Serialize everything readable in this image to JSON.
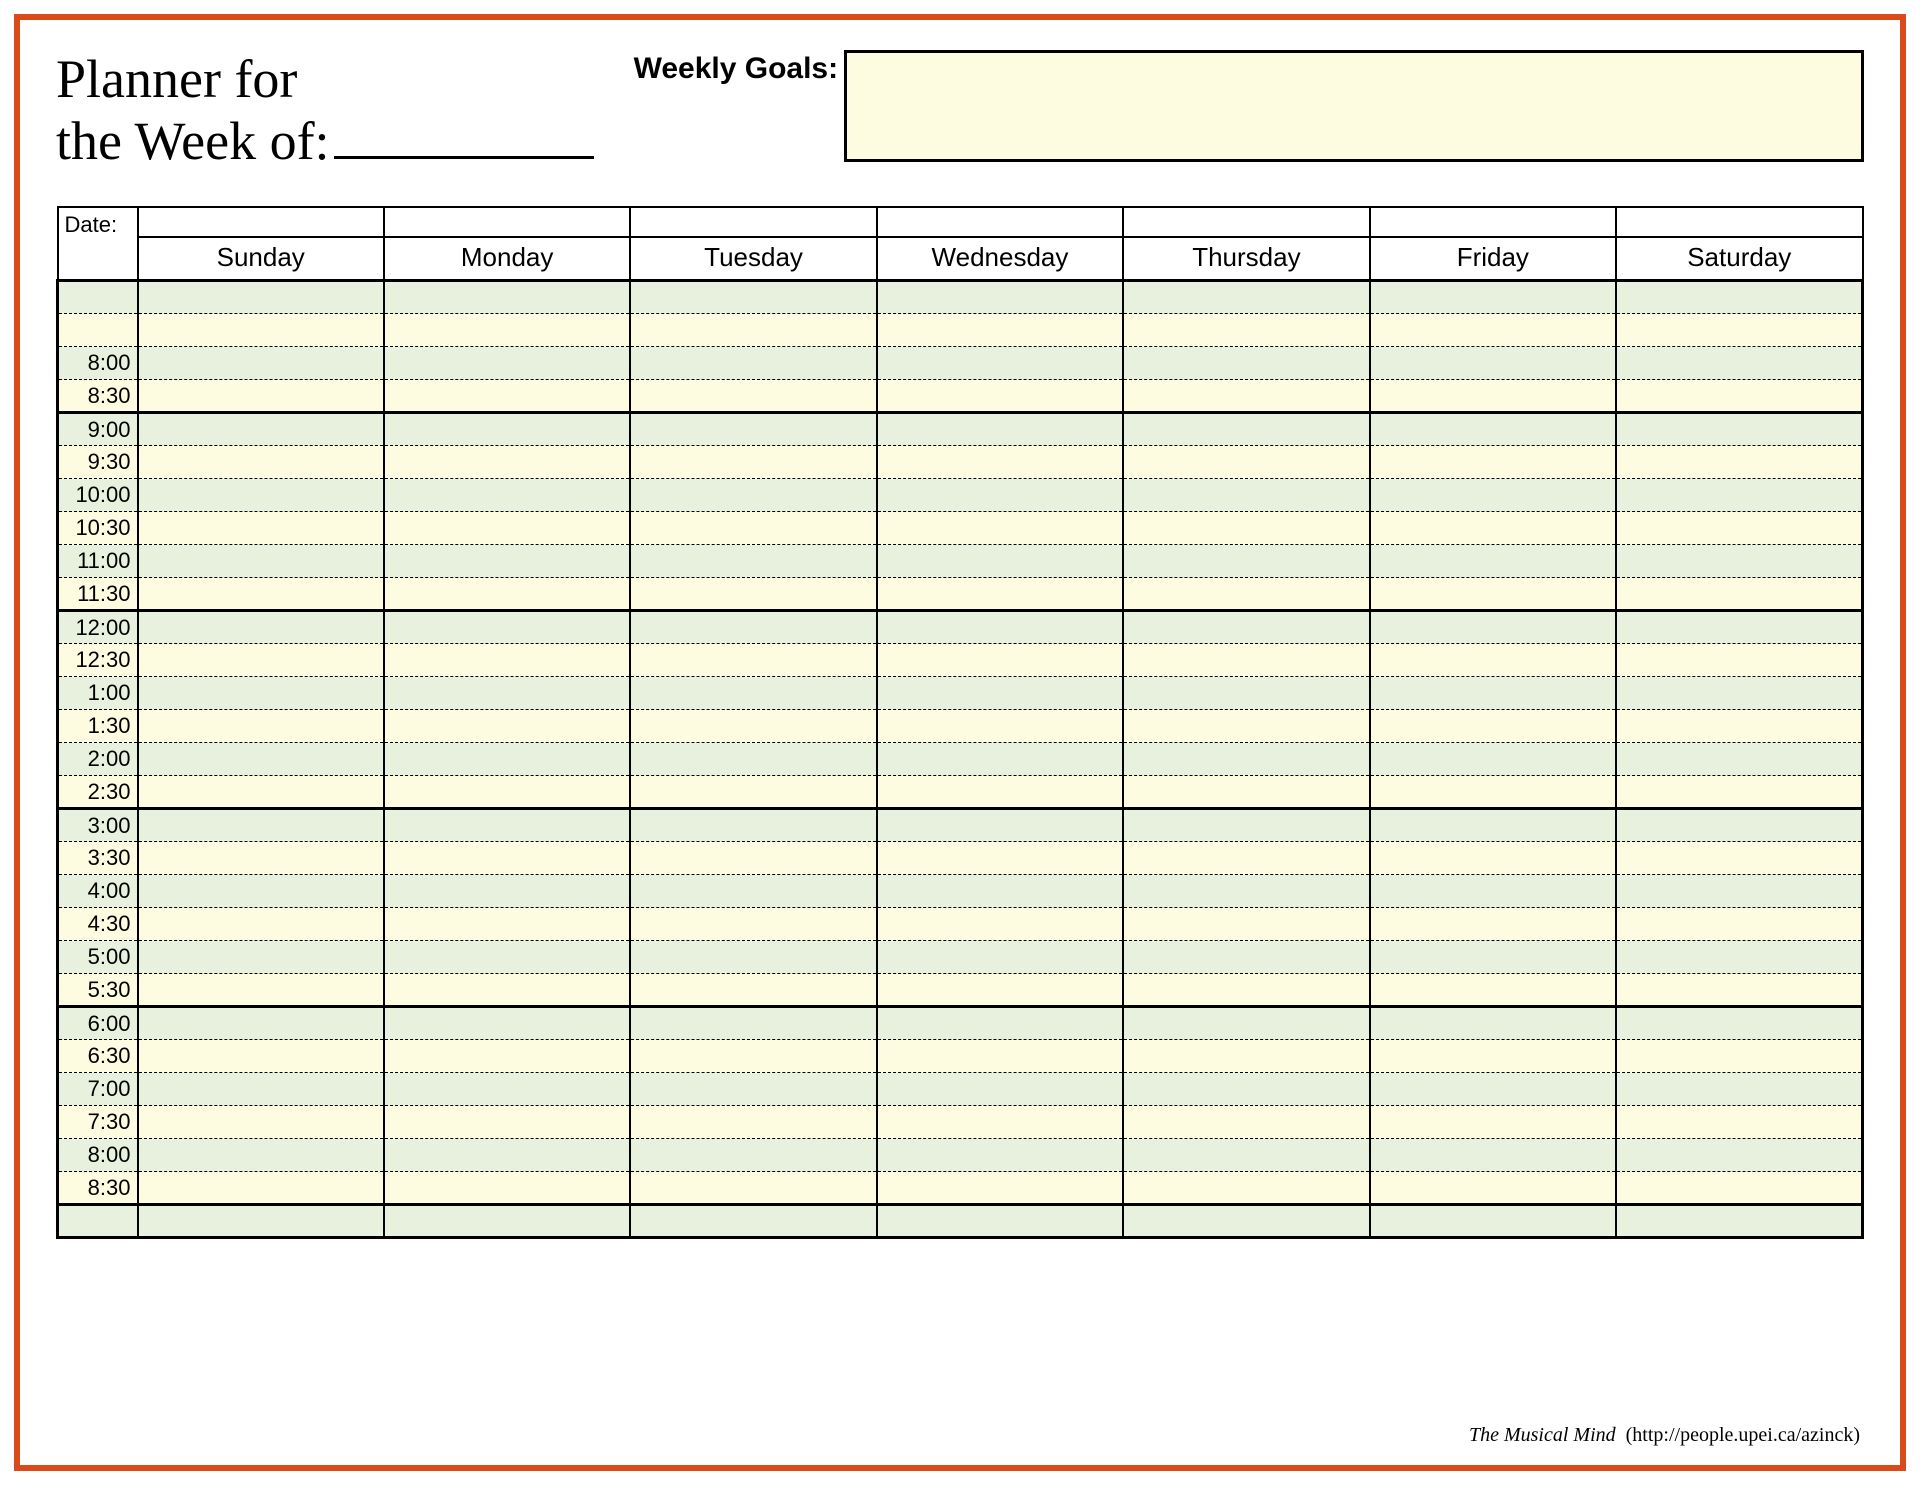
{
  "header": {
    "title_line1": "Planner for",
    "title_line2": "the Week of:",
    "goals_label": "Weekly Goals:"
  },
  "table": {
    "date_label": "Date:",
    "days": [
      "Sunday",
      "Monday",
      "Tuesday",
      "Wednesday",
      "Thursday",
      "Friday",
      "Saturday"
    ],
    "rows": [
      {
        "time": "",
        "shade": "green",
        "section": true
      },
      {
        "time": "",
        "shade": "cream",
        "section": false
      },
      {
        "time": "8:00",
        "shade": "green",
        "section": false
      },
      {
        "time": "8:30",
        "shade": "cream",
        "section": false
      },
      {
        "time": "9:00",
        "shade": "green",
        "section": true
      },
      {
        "time": "9:30",
        "shade": "cream",
        "section": false
      },
      {
        "time": "10:00",
        "shade": "green",
        "section": false
      },
      {
        "time": "10:30",
        "shade": "cream",
        "section": false
      },
      {
        "time": "11:00",
        "shade": "green",
        "section": false
      },
      {
        "time": "11:30",
        "shade": "cream",
        "section": false
      },
      {
        "time": "12:00",
        "shade": "green",
        "section": true
      },
      {
        "time": "12:30",
        "shade": "cream",
        "section": false
      },
      {
        "time": "1:00",
        "shade": "green",
        "section": false
      },
      {
        "time": "1:30",
        "shade": "cream",
        "section": false
      },
      {
        "time": "2:00",
        "shade": "green",
        "section": false
      },
      {
        "time": "2:30",
        "shade": "cream",
        "section": false
      },
      {
        "time": "3:00",
        "shade": "green",
        "section": true
      },
      {
        "time": "3:30",
        "shade": "cream",
        "section": false
      },
      {
        "time": "4:00",
        "shade": "green",
        "section": false
      },
      {
        "time": "4:30",
        "shade": "cream",
        "section": false
      },
      {
        "time": "5:00",
        "shade": "green",
        "section": false
      },
      {
        "time": "5:30",
        "shade": "cream",
        "section": false
      },
      {
        "time": "6:00",
        "shade": "green",
        "section": true
      },
      {
        "time": "6:30",
        "shade": "cream",
        "section": false
      },
      {
        "time": "7:00",
        "shade": "green",
        "section": false
      },
      {
        "time": "7:30",
        "shade": "cream",
        "section": false
      },
      {
        "time": "8:00",
        "shade": "green",
        "section": false
      },
      {
        "time": "8:30",
        "shade": "cream",
        "section": false
      },
      {
        "time": "",
        "shade": "green",
        "section": true
      }
    ]
  },
  "footer": {
    "credit": "The Musical Mind",
    "url": "(http://people.upei.ca/azinck)"
  },
  "colors": {
    "frame_border": "#d94b1a",
    "green_shade": "#e8f0de",
    "cream_shade": "#fefce0"
  }
}
